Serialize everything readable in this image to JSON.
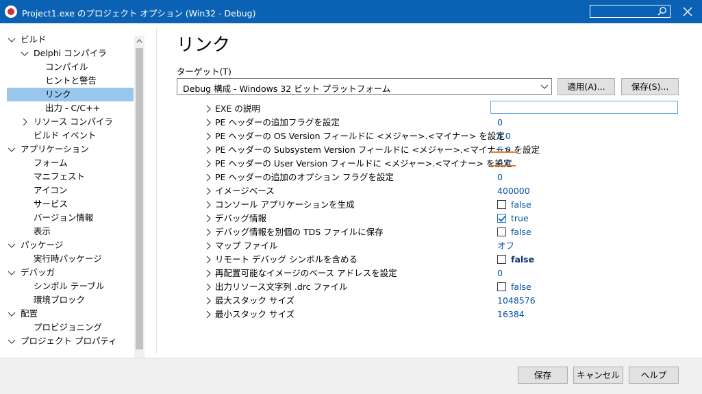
{
  "window": {
    "title": "Project1.exe のプロジェクト オプション  (Win32 - Debug)",
    "search_placeholder": ""
  },
  "tree": {
    "items": [
      {
        "label": "ビルド",
        "level": 0,
        "expanded": true
      },
      {
        "label": "Delphi コンパイラ",
        "level": 1,
        "expanded": true
      },
      {
        "label": "コンパイル",
        "level": 2
      },
      {
        "label": "ヒントと警告",
        "level": 2
      },
      {
        "label": "リンク",
        "level": 2,
        "selected": true
      },
      {
        "label": "出力 - C/C++",
        "level": 2
      },
      {
        "label": "リソース コンパイラ",
        "level": 1,
        "expanded": false
      },
      {
        "label": "ビルド イベント",
        "level": 1
      },
      {
        "label": "アプリケーション",
        "level": 0,
        "expanded": true
      },
      {
        "label": "フォーム",
        "level": 1
      },
      {
        "label": "マニフェスト",
        "level": 1
      },
      {
        "label": "アイコン",
        "level": 1
      },
      {
        "label": "サービス",
        "level": 1
      },
      {
        "label": "バージョン情報",
        "level": 1
      },
      {
        "label": "表示",
        "level": 1
      },
      {
        "label": "パッケージ",
        "level": 0,
        "expanded": true
      },
      {
        "label": "実行時パッケージ",
        "level": 1
      },
      {
        "label": "デバッガ",
        "level": 0,
        "expanded": true
      },
      {
        "label": "シンボル テーブル",
        "level": 1
      },
      {
        "label": "環境ブロック",
        "level": 1
      },
      {
        "label": "配置",
        "level": 0,
        "expanded": true
      },
      {
        "label": "プロビジョニング",
        "level": 1
      },
      {
        "label": "プロジェクト プロパティ",
        "level": 0,
        "expanded": true
      }
    ]
  },
  "page": {
    "title": "リンク",
    "target_label": "ターゲット(T)",
    "target_value": "Debug 構成 - Windows 32 ビット プラットフォーム",
    "apply_label": "適用(A)...",
    "save_as_label": "保存(S)..."
  },
  "properties": [
    {
      "name": "EXE の説明",
      "type": "input",
      "value": ""
    },
    {
      "name": "PE ヘッダーの追加フラグを設定",
      "type": "text",
      "value": "0"
    },
    {
      "name": "PE ヘッダーの OS Version フィールドに <メジャー>.<マイナー> を設定",
      "type": "text",
      "value": "6.0"
    },
    {
      "name": "PE ヘッダーの Subsystem Version フィールドに <メジャー>.<マイナー> を設定",
      "type": "text",
      "value": "6.0"
    },
    {
      "name": "PE ヘッダーの User Version フィールドに <メジャー>.<マイナー> を設定",
      "type": "text",
      "value": "0.0"
    },
    {
      "name": "PE ヘッダーの追加のオプション フラグを設定",
      "type": "text",
      "value": "0"
    },
    {
      "name": "イメージベース",
      "type": "text",
      "value": "400000"
    },
    {
      "name": "コンソール アプリケーションを生成",
      "type": "checkbox",
      "checked": false,
      "value": "false"
    },
    {
      "name": "デバッグ情報",
      "type": "checkbox",
      "checked": true,
      "value": "true"
    },
    {
      "name": "デバッグ情報を別個の TDS ファイルに保存",
      "type": "checkbox",
      "checked": false,
      "value": "false"
    },
    {
      "name": "マップ ファイル",
      "type": "text",
      "value": "オフ"
    },
    {
      "name": "リモート デバッグ シンボルを含める",
      "type": "checkbox",
      "checked": false,
      "value": "false",
      "bold": true
    },
    {
      "name": "再配置可能なイメージのベース アドレスを設定",
      "type": "text",
      "value": "0"
    },
    {
      "name": "出力リソース文字列 .drc ファイル",
      "type": "checkbox",
      "checked": false,
      "value": "false"
    },
    {
      "name": "最大スタック サイズ",
      "type": "text",
      "value": "1048576"
    },
    {
      "name": "最小スタック サイズ",
      "type": "text",
      "value": "16384"
    }
  ],
  "footer": {
    "save_label": "保存",
    "cancel_label": "キャンセル",
    "help_label": "ヘルプ"
  },
  "colors": {
    "titlebar": "#0b62b4",
    "selection": "#99c6ec",
    "value_text": "#0052a3",
    "annotation": "#f07820"
  }
}
